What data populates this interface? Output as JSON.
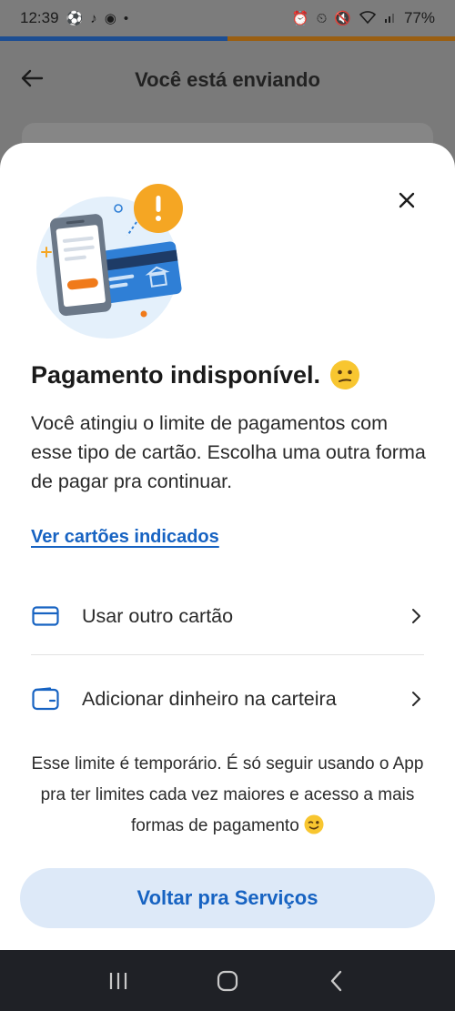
{
  "status_bar": {
    "time": "12:39",
    "battery": "77%",
    "left_icons": [
      "soccer-ball-icon",
      "tiktok-icon",
      "chrome-icon",
      "dot-icon"
    ],
    "right_icons": [
      "alarm-icon",
      "alarm-clock-icon",
      "mute-icon",
      "wifi-icon",
      "signal-icon"
    ]
  },
  "background_page": {
    "title": "Você está enviando"
  },
  "sheet": {
    "title": "Pagamento indisponível.",
    "description": "Você atingiu o limite de pagamentos com esse tipo de cartão. Escolha uma outra forma de pagar pra continuar.",
    "link_label": "Ver cartões indicados",
    "options": [
      {
        "label": "Usar outro cartão",
        "icon": "credit-card-icon"
      },
      {
        "label": "Adicionar dinheiro na carteira",
        "icon": "wallet-icon"
      }
    ],
    "note": "Esse limite é temporário. É só seguir usando o App pra ter limites cada vez maiores e acesso a mais formas de pagamento",
    "primary_button": "Voltar pra Serviços"
  },
  "colors": {
    "accent": "#1763c2",
    "button_bg": "#dde9f8",
    "overlay": "#7a7a7a",
    "nav_bg": "#1f2126"
  }
}
